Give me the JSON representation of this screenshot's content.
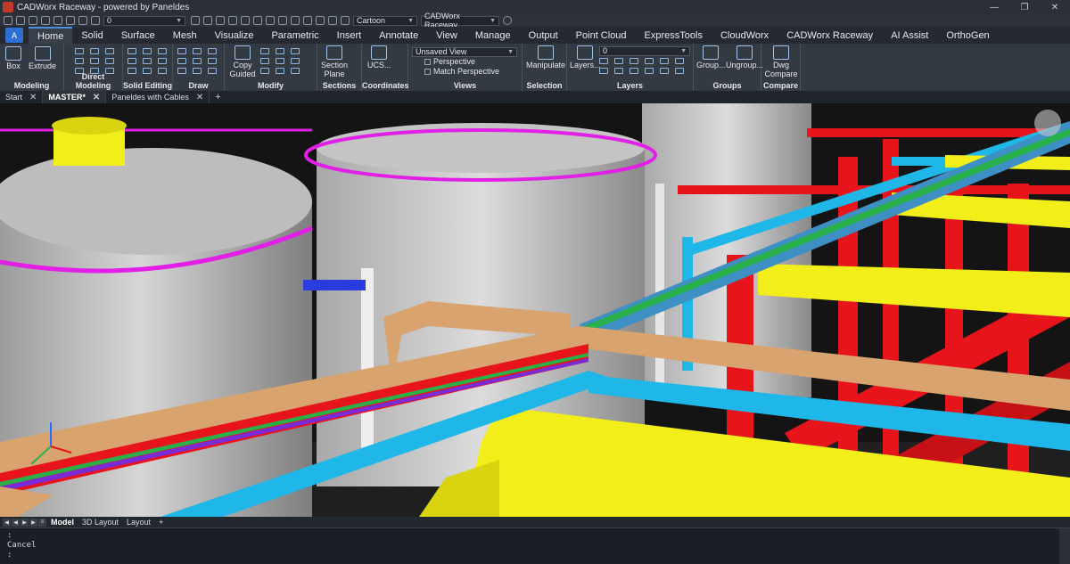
{
  "window": {
    "title": "CADWorx Raceway - powered by Paneldes",
    "controls": [
      "—",
      "❐",
      "✕"
    ]
  },
  "qat": {
    "layer_combo": "0",
    "visual_style": "Cartoon",
    "workspace": "CADWorx Raceway"
  },
  "ribbon_tabs": [
    "Home",
    "Solid",
    "Surface",
    "Mesh",
    "Visualize",
    "Parametric",
    "Insert",
    "Annotate",
    "View",
    "Manage",
    "Output",
    "Point Cloud",
    "ExpressTools",
    "CloudWorx",
    "CADWorx Raceway",
    "AI Assist",
    "OrthoGen"
  ],
  "app_button": "A",
  "ribbon": {
    "modeling": {
      "title": "Modeling",
      "box": "Box",
      "extrude": "Extrude"
    },
    "direct_modeling": {
      "title": "Direct Modeling"
    },
    "solid_editing": {
      "title": "Solid Editing"
    },
    "draw": {
      "title": "Draw"
    },
    "modify": {
      "title": "Modify",
      "copy_guided": "Copy Guided"
    },
    "sections": {
      "title": "Sections",
      "section_plane": "Section Plane"
    },
    "coordinates": {
      "title": "Coordinates",
      "ucs": "UCS..."
    },
    "views": {
      "title": "Views",
      "view_combo": "Unsaved View",
      "perspective": "Perspective",
      "match_perspective": "Match Perspective"
    },
    "selection": {
      "title": "Selection",
      "manipulate": "Manipulate"
    },
    "layers": {
      "title": "Layers",
      "layers_btn": "Layers...",
      "layer_value": "0"
    },
    "groups": {
      "title": "Groups",
      "group": "Group...",
      "ungroup": "Ungroup..."
    },
    "compare": {
      "title": "Compare",
      "dwg_compare": "Dwg Compare"
    }
  },
  "doc_tabs": [
    {
      "label": "Start",
      "active": false
    },
    {
      "label": "MASTER*",
      "active": true
    },
    {
      "label": "Paneldes with Cables",
      "active": false
    }
  ],
  "layout_tabs": [
    "Model",
    "3D Layout",
    "Layout"
  ],
  "command_line": {
    "lines": [
      ":",
      "Cancel",
      ":"
    ]
  },
  "colors": {
    "accent": "#2f6fd3",
    "tray_tan": "#d9a36f",
    "pipe_red": "#e8141c",
    "beam_yellow": "#f2ee1a",
    "pipe_cyan": "#1fb6e8",
    "rail_magenta": "#e21fe6",
    "tank_grey": "#c8c8c8"
  }
}
